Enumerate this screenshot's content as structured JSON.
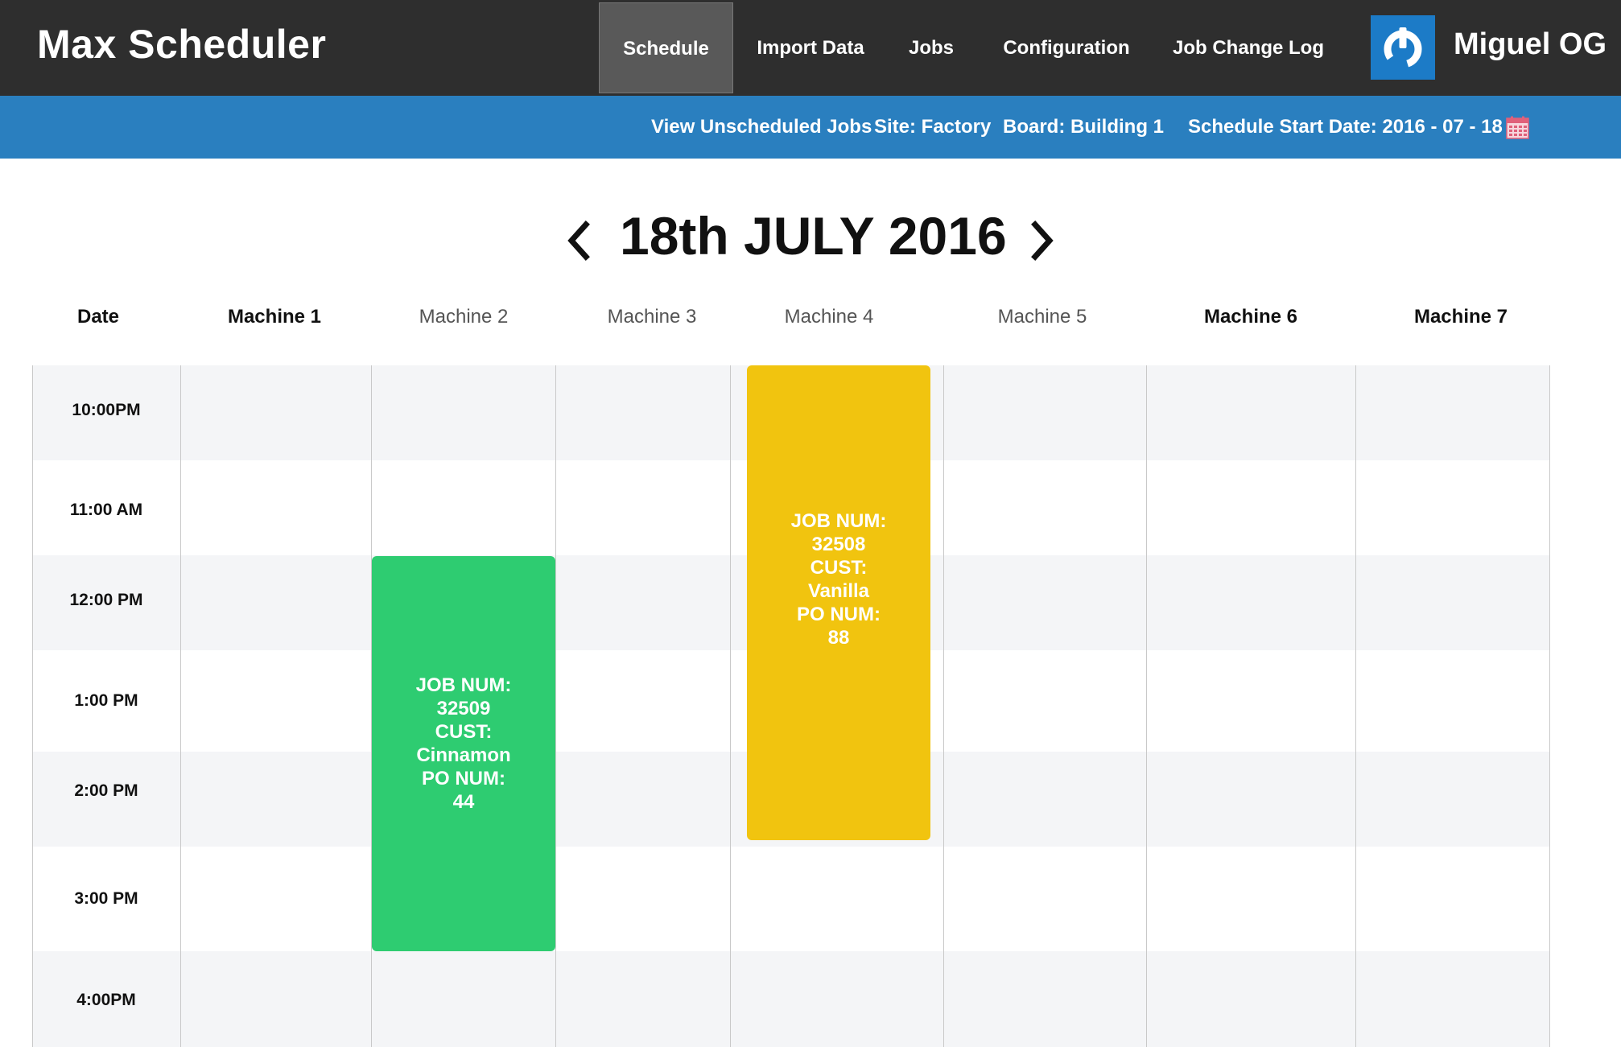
{
  "app": {
    "title": "Max Scheduler"
  },
  "nav": {
    "schedule": "Schedule",
    "import_data": "Import Data",
    "jobs": "Jobs",
    "configuration": "Configuration",
    "job_change_log": "Job Change Log"
  },
  "user": {
    "name": "Miguel OG",
    "power_icon": "power-icon"
  },
  "subnav": {
    "unscheduled": "View Unscheduled Jobs",
    "site": "Site: Factory",
    "board": "Board: Building 1",
    "start_date": "Schedule Start Date: 2016 - 07 - 18",
    "calendar_icon": "calendar-icon"
  },
  "schedule": {
    "date_title": "18th  JULY 2016",
    "prev_icon": "chevron-left-icon",
    "next_icon": "chevron-right-icon",
    "columns": {
      "date": "Date",
      "m1": "Machine 1",
      "m2": "Machine 2",
      "m3": "Machine 3",
      "m4": "Machine 4",
      "m5": "Machine 5",
      "m6": "Machine 6",
      "m7": "Machine 7"
    },
    "times": [
      "10:00PM",
      "11:00 AM",
      "12:00 PM",
      "1:00 PM",
      "2:00 PM",
      "3:00 PM",
      "4:00PM"
    ]
  },
  "jobs": [
    {
      "machine": "Machine 2",
      "color": "#2ecc71",
      "lines": [
        "JOB NUM:",
        "32509",
        "CUST:",
        "Cinnamon",
        "PO NUM:",
        "44"
      ]
    },
    {
      "machine": "Machine 4",
      "color": "#f1c40f",
      "lines": [
        "JOB  NUM:",
        "32508",
        "CUST:",
        "Vanilla",
        "PO NUM:",
        "88"
      ]
    }
  ]
}
